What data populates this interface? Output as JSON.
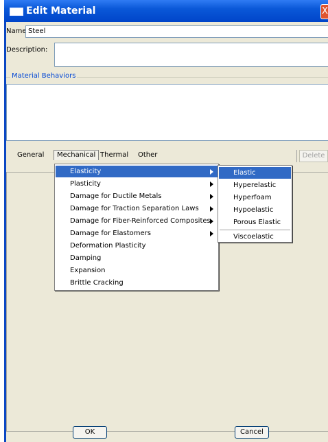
{
  "window": {
    "title": "Edit Material",
    "close_glyph": "X"
  },
  "name": {
    "label": "Name:",
    "value": "Steel"
  },
  "description": {
    "label": "Description:",
    "value": ""
  },
  "behaviors": {
    "title": "Material Behaviors"
  },
  "menubar": {
    "items": [
      "General",
      "Mechanical",
      "Thermal",
      "Other"
    ],
    "delete_label": "Delete"
  },
  "mechanical_menu": [
    {
      "label": "Elasticity",
      "submenu": true,
      "highlighted": true
    },
    {
      "label": "Plasticity",
      "submenu": true
    },
    {
      "label": "Damage for Ductile Metals",
      "submenu": true
    },
    {
      "label": "Damage for Traction Separation Laws",
      "submenu": true
    },
    {
      "label": "Damage for Fiber-Reinforced Composites",
      "submenu": true
    },
    {
      "label": "Damage for Elastomers",
      "submenu": true
    },
    {
      "label": "Deformation Plasticity",
      "submenu": false
    },
    {
      "label": "Damping",
      "submenu": false
    },
    {
      "label": "Expansion",
      "submenu": false
    },
    {
      "label": "Brittle Cracking",
      "submenu": false
    }
  ],
  "elasticity_submenu": [
    {
      "label": "Elastic",
      "highlighted": true
    },
    {
      "label": "Hyperelastic"
    },
    {
      "label": "Hyperfoam"
    },
    {
      "label": "Hypoelastic"
    },
    {
      "label": "Porous Elastic"
    },
    {
      "label": "Viscoelastic"
    }
  ],
  "buttons": {
    "ok": "OK",
    "cancel": "Cancel"
  },
  "colors": {
    "titlebar": "#0a58d8",
    "highlight": "#316ac5",
    "group_title": "#0046d5",
    "dialog_bg": "#ece9d8"
  }
}
